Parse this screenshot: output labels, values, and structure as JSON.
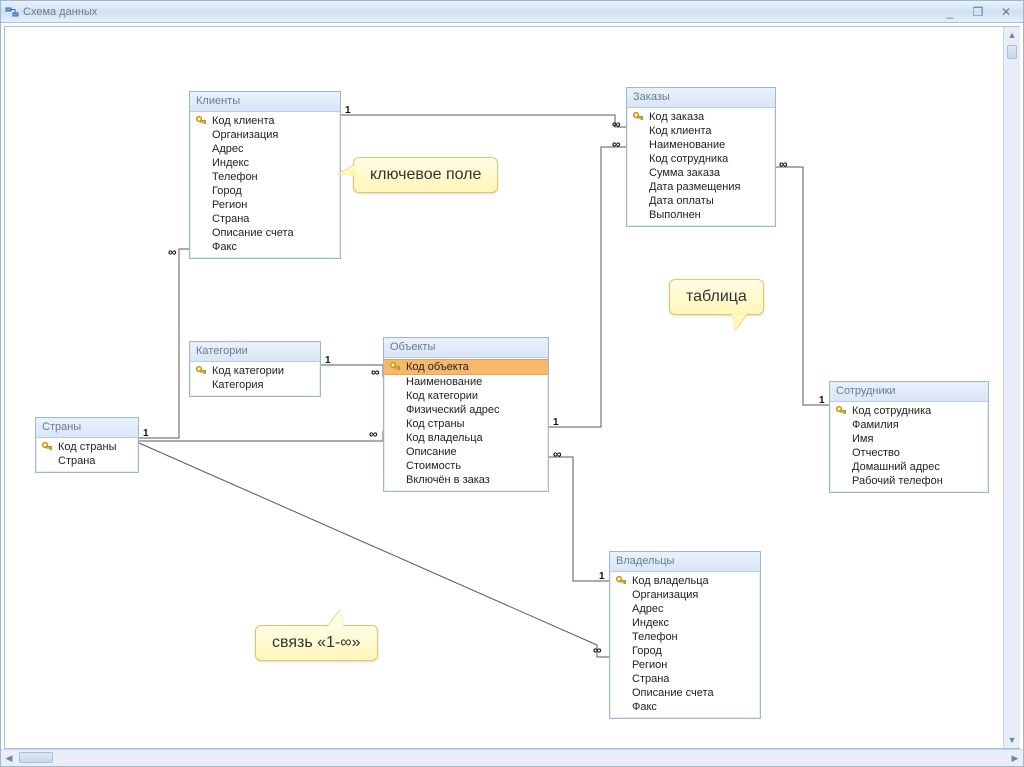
{
  "window": {
    "title": "Схема данных",
    "buttons": {
      "min": "_",
      "max": "❐",
      "close": "✕"
    }
  },
  "callouts": {
    "key_field": "ключевое поле",
    "table": "таблица",
    "relation": "связь «1-∞»"
  },
  "rel": {
    "one": "1",
    "many": "∞"
  },
  "entities": {
    "countries": {
      "title": "Страны",
      "fields": [
        {
          "name": "Код страны",
          "key": true
        },
        {
          "name": "Страна",
          "key": false
        }
      ]
    },
    "clients": {
      "title": "Клиенты",
      "fields": [
        {
          "name": "Код клиента",
          "key": true
        },
        {
          "name": "Организация"
        },
        {
          "name": "Адрес"
        },
        {
          "name": "Индекс"
        },
        {
          "name": "Телефон"
        },
        {
          "name": "Город"
        },
        {
          "name": "Регион"
        },
        {
          "name": "Страна"
        },
        {
          "name": "Описание счета"
        },
        {
          "name": "Факс"
        }
      ]
    },
    "categories": {
      "title": "Категории",
      "fields": [
        {
          "name": "Код категории",
          "key": true
        },
        {
          "name": "Категория"
        }
      ]
    },
    "objects": {
      "title": "Объекты",
      "selected": 0,
      "fields": [
        {
          "name": "Код объекта",
          "key": true
        },
        {
          "name": "Наименование"
        },
        {
          "name": "Код категории"
        },
        {
          "name": "Физический адрес"
        },
        {
          "name": "Код страны"
        },
        {
          "name": "Код владельца"
        },
        {
          "name": "Описание"
        },
        {
          "name": "Стоимость"
        },
        {
          "name": "Включён в заказ"
        }
      ]
    },
    "orders": {
      "title": "Заказы",
      "fields": [
        {
          "name": "Код заказа",
          "key": true
        },
        {
          "name": "Код клиента"
        },
        {
          "name": "Наименование"
        },
        {
          "name": "Код сотрудника"
        },
        {
          "name": "Сумма заказа"
        },
        {
          "name": "Дата размещения"
        },
        {
          "name": "Дата оплаты"
        },
        {
          "name": "Выполнен"
        }
      ]
    },
    "owners": {
      "title": "Владельцы",
      "fields": [
        {
          "name": "Код владельца",
          "key": true
        },
        {
          "name": "Организация"
        },
        {
          "name": "Адрес"
        },
        {
          "name": "Индекс"
        },
        {
          "name": "Телефон"
        },
        {
          "name": "Город"
        },
        {
          "name": "Регион"
        },
        {
          "name": "Страна"
        },
        {
          "name": "Описание счета"
        },
        {
          "name": "Факс"
        }
      ]
    },
    "employees": {
      "title": "Сотрудники",
      "fields": [
        {
          "name": "Код сотрудника",
          "key": true
        },
        {
          "name": "Фамилия"
        },
        {
          "name": "Имя"
        },
        {
          "name": "Отчество"
        },
        {
          "name": "Домашний адрес"
        },
        {
          "name": "Рабочий телефон"
        }
      ]
    }
  },
  "relations": [
    {
      "from": "clients",
      "to": "orders",
      "card": "1:∞"
    },
    {
      "from": "countries",
      "to": "clients",
      "card": "1:∞"
    },
    {
      "from": "countries",
      "to": "objects",
      "card": "1:∞"
    },
    {
      "from": "countries",
      "to": "owners",
      "card": "1:∞"
    },
    {
      "from": "categories",
      "to": "objects",
      "card": "1:∞"
    },
    {
      "from": "objects",
      "to": "orders",
      "card": "1:∞"
    },
    {
      "from": "owners",
      "to": "objects",
      "card": "1:∞"
    },
    {
      "from": "employees",
      "to": "orders",
      "card": "1:∞"
    }
  ]
}
